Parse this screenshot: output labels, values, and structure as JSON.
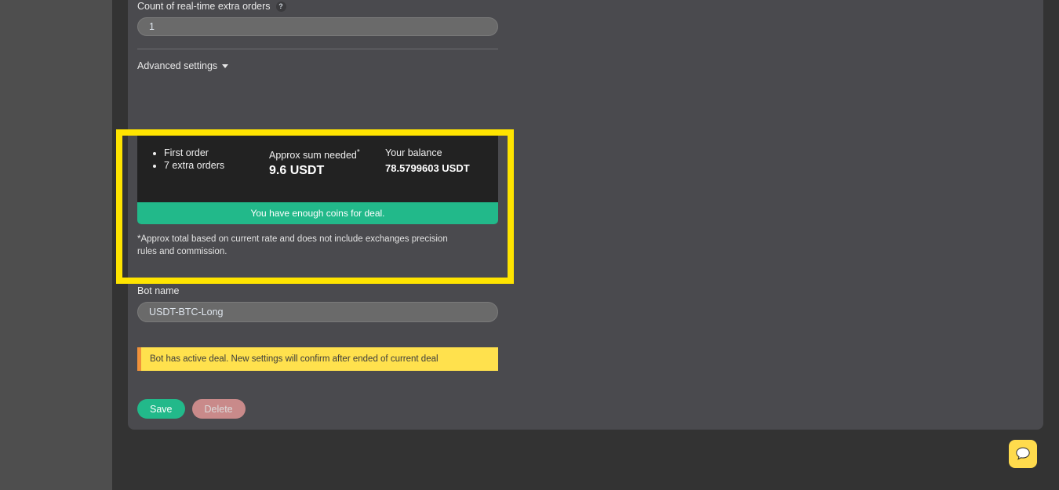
{
  "form": {
    "extra_orders_count_value": "7",
    "realtime_label": "Count of real-time extra orders",
    "realtime_help_icon": "question-mark-icon",
    "realtime_value": "1",
    "advanced_settings_label": "Advanced settings",
    "advanced_settings_caret": "chevron-down-icon"
  },
  "summary": {
    "orders": [
      "First order",
      "7 extra orders"
    ],
    "needed_title": "Approx sum needed",
    "needed_title_asterisk": "*",
    "needed_value": "9.6 USDT",
    "balance_title": "Your balance",
    "balance_value": "78.5799603 USDT",
    "enough_banner": "You have enough coins for deal.",
    "approx_note": "*Approx total based on current rate and does not include exchanges precision rules and commission.",
    "banner_color": "#22b98a",
    "panel_color": "#222222"
  },
  "bot_name": {
    "label": "Bot name",
    "value": "USDT-BTC-Long"
  },
  "warning": {
    "text": "Bot has active deal. New settings will confirm after ended of current deal",
    "background_color": "#ffe14d",
    "accent_color": "#f0913a"
  },
  "actions": {
    "save_label": "Save",
    "delete_label": "Delete",
    "save_color": "#22b98a",
    "delete_color": "#c98a8a"
  },
  "chat": {
    "icon": "chat-bubble-icon",
    "background_color": "#ffdb4d"
  },
  "annotation": {
    "highlight_color": "#ffe400"
  }
}
